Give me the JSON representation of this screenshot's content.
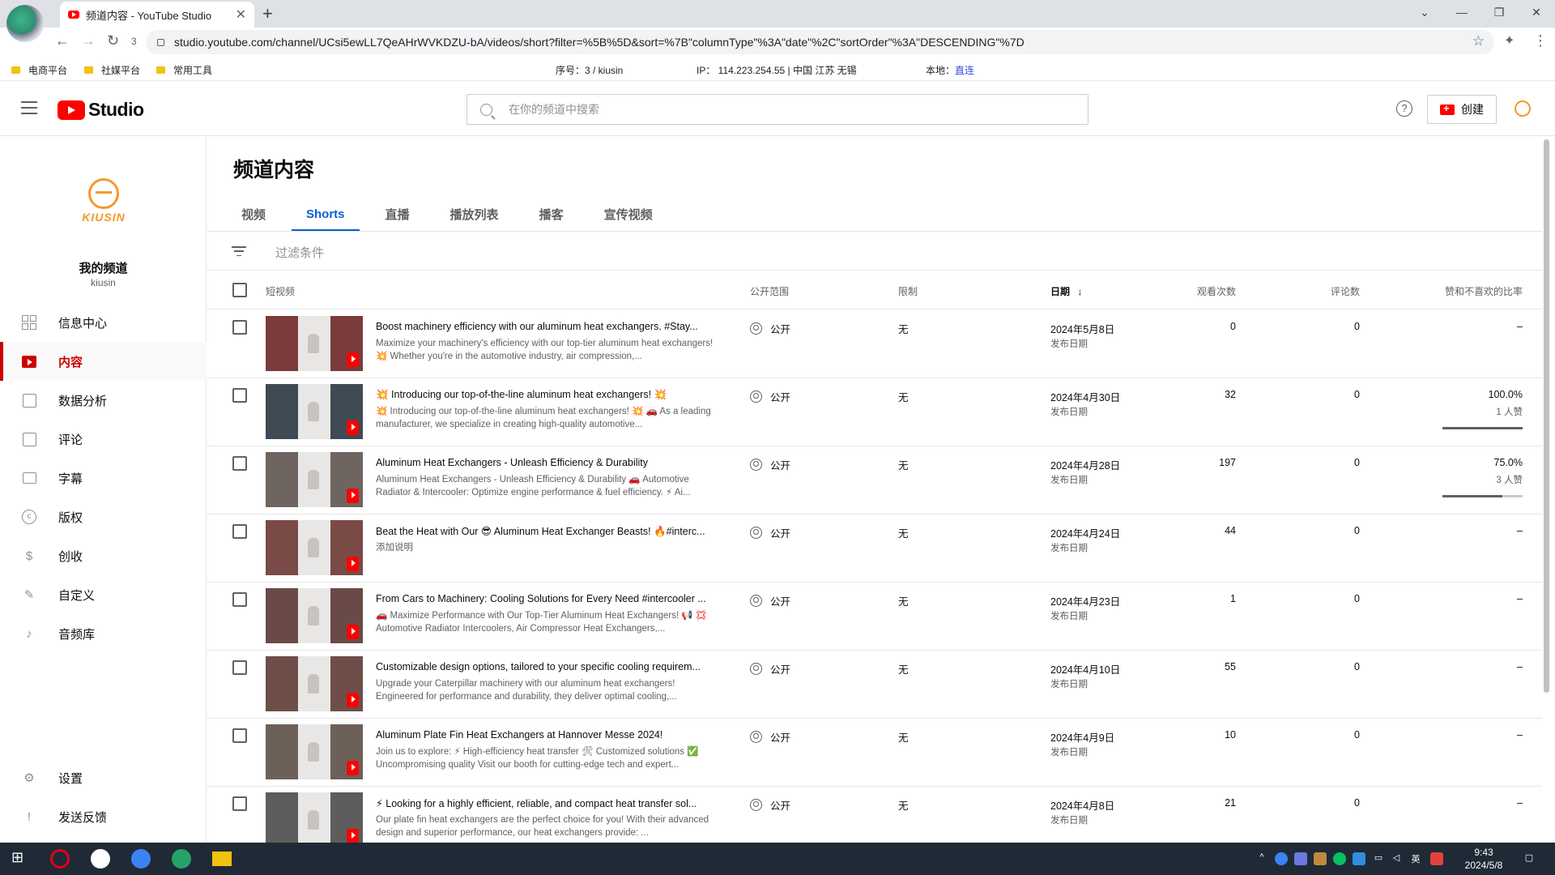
{
  "browser": {
    "tab_title": "频道内容 - YouTube Studio",
    "tab_close": "✕",
    "new_tab": "+",
    "url": "studio.youtube.com/channel/UCsi5ewLL7QeAHrWVKDZU-bA/videos/short?filter=%5B%5D&sort=%7B\"columnType\"%3A\"date\"%2C\"sortOrder\"%3A\"DESCENDING\"%7D",
    "ext_count": "3",
    "bookmarks": [
      "电商平台",
      "社媒平台",
      "常用工具"
    ],
    "info_seq": "序号：3 / kiusin",
    "info_ip": "IP： 114.223.254.55 | 中国 江苏 无锡",
    "info_local_label": "本地：",
    "info_local_link": "直连"
  },
  "header": {
    "logo_text": "Studio",
    "search_placeholder": "在你的频道中搜索",
    "help": "?",
    "create_label": "创建"
  },
  "sidebar": {
    "channel_brand": "KIUSIN",
    "channel_name": "我的频道",
    "channel_handle": "kiusin",
    "items": [
      {
        "label": "信息中心",
        "icon": "dashboard-icon"
      },
      {
        "label": "内容",
        "icon": "content-icon"
      },
      {
        "label": "数据分析",
        "icon": "analytics-icon"
      },
      {
        "label": "评论",
        "icon": "comments-icon"
      },
      {
        "label": "字幕",
        "icon": "subtitles-icon"
      },
      {
        "label": "版权",
        "icon": "copyright-icon"
      },
      {
        "label": "创收",
        "icon": "monetization-icon"
      },
      {
        "label": "自定义",
        "icon": "customization-icon"
      },
      {
        "label": "音频库",
        "icon": "audio-library-icon"
      }
    ],
    "settings": "设置",
    "feedback": "发送反馈"
  },
  "main": {
    "title": "频道内容",
    "tabs": [
      "视频",
      "Shorts",
      "直播",
      "播放列表",
      "播客",
      "宣传视频"
    ],
    "active_tab": "Shorts",
    "filter_placeholder": "过滤条件",
    "columns": {
      "video": "短视频",
      "visibility": "公开范围",
      "restrictions": "限制",
      "date": "日期",
      "date_sort": "↓",
      "views": "观看次数",
      "comments": "评论数",
      "likes": "赞和不喜欢的比率"
    },
    "rows": [
      {
        "title": "Boost machinery efficiency with our aluminum heat exchangers. #Stay...",
        "desc": "Maximize your machinery's efficiency with our top-tier aluminum heat exchangers! 💥 Whether you're in the automotive industry, air compression,...",
        "visibility": "公开",
        "restriction": "无",
        "date": "2024年5月8日",
        "date_sub": "发布日期",
        "views": "0",
        "comments": "0",
        "likes": "–",
        "likes_sub": "",
        "like_ratio": null
      },
      {
        "title": "💥 Introducing our top-of-the-line aluminum heat exchangers! 💥",
        "desc": "💥 Introducing our top-of-the-line aluminum heat exchangers! 💥 🚗 As a leading manufacturer, we specialize in creating high-quality automotive...",
        "visibility": "公开",
        "restriction": "无",
        "date": "2024年4月30日",
        "date_sub": "发布日期",
        "views": "32",
        "comments": "0",
        "likes": "100.0%",
        "likes_sub": "1 人赞",
        "like_ratio": 1.0
      },
      {
        "title": "Aluminum Heat Exchangers - Unleash Efficiency & Durability",
        "desc": "Aluminum Heat Exchangers - Unleash Efficiency & Durability 🚗 Automotive Radiator & Intercooler: Optimize engine performance & fuel efficiency. ⚡ Ai...",
        "visibility": "公开",
        "restriction": "无",
        "date": "2024年4月28日",
        "date_sub": "发布日期",
        "views": "197",
        "comments": "0",
        "likes": "75.0%",
        "likes_sub": "3 人赞",
        "like_ratio": 0.75
      },
      {
        "title": "Beat the Heat with Our 😎 Aluminum Heat Exchanger Beasts! 🔥#interc...",
        "desc": "添加说明",
        "visibility": "公开",
        "restriction": "无",
        "date": "2024年4月24日",
        "date_sub": "发布日期",
        "views": "44",
        "comments": "0",
        "likes": "–",
        "likes_sub": "",
        "like_ratio": null
      },
      {
        "title": "From Cars to Machinery: Cooling Solutions for Every Need #intercooler ...",
        "desc": "🚗 Maximize Performance with Our Top-Tier Aluminum Heat Exchangers! 📢 💢 Automotive Radiator Intercoolers, Air Compressor Heat Exchangers,...",
        "visibility": "公开",
        "restriction": "无",
        "date": "2024年4月23日",
        "date_sub": "发布日期",
        "views": "1",
        "comments": "0",
        "likes": "–",
        "likes_sub": "",
        "like_ratio": null
      },
      {
        "title": "Customizable design options, tailored to your specific cooling requirem...",
        "desc": "Upgrade your Caterpillar machinery with our aluminum heat exchangers! Engineered for performance and durability, they deliver optimal cooling,...",
        "visibility": "公开",
        "restriction": "无",
        "date": "2024年4月10日",
        "date_sub": "发布日期",
        "views": "55",
        "comments": "0",
        "likes": "–",
        "likes_sub": "",
        "like_ratio": null
      },
      {
        "title": "Aluminum Plate Fin Heat Exchangers at Hannover Messe 2024!",
        "desc": "Join us to explore: ⚡ High-efficiency heat transfer 🛠 Customized solutions ✅ Uncompromising quality Visit our booth for cutting-edge tech and expert...",
        "visibility": "公开",
        "restriction": "无",
        "date": "2024年4月9日",
        "date_sub": "发布日期",
        "views": "10",
        "comments": "0",
        "likes": "–",
        "likes_sub": "",
        "like_ratio": null
      },
      {
        "title": "⚡ Looking for a highly efficient, reliable, and compact heat transfer sol...",
        "desc": "Our plate fin heat exchangers are the perfect choice for you! With their advanced design and superior performance, our heat exchangers provide: ...",
        "visibility": "公开",
        "restriction": "无",
        "date": "2024年4月8日",
        "date_sub": "发布日期",
        "views": "21",
        "comments": "0",
        "likes": "–",
        "likes_sub": "",
        "like_ratio": null
      }
    ]
  },
  "taskbar": {
    "time": "9:43",
    "date": "2024/5/8",
    "ime": "英"
  },
  "colors": {
    "accent_blue": "#065fd4",
    "active_red": "#cc0000",
    "brand_orange": "#f39a2b"
  }
}
